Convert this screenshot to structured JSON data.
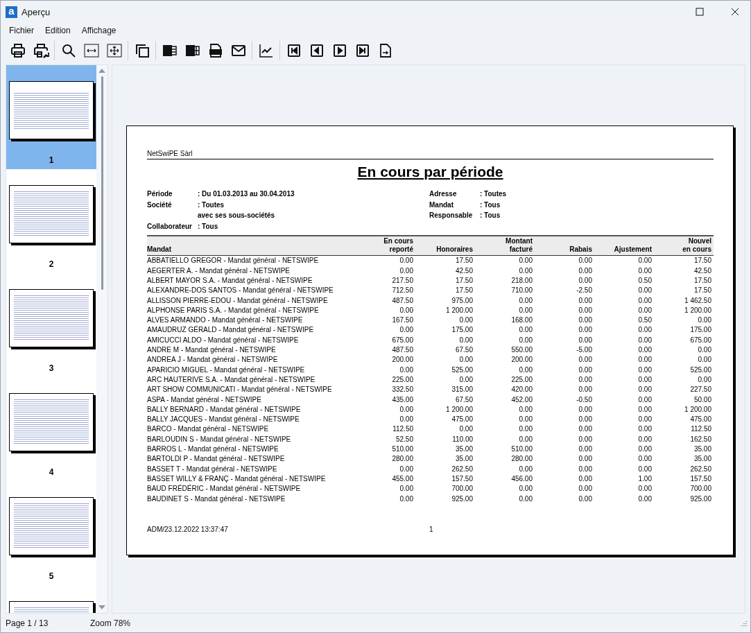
{
  "window": {
    "logo": "a",
    "title": "Aperçu"
  },
  "menu": [
    "Fichier",
    "Edition",
    "Affichage"
  ],
  "thumbnails": [
    {
      "label": "1",
      "selected": true
    },
    {
      "label": "2",
      "selected": false
    },
    {
      "label": "3",
      "selected": false
    },
    {
      "label": "4",
      "selected": false
    },
    {
      "label": "5",
      "selected": false
    },
    {
      "selected": false
    }
  ],
  "report": {
    "company": "NetSwiPE Sàrl",
    "title": "En cours par période",
    "filters_left": [
      {
        "label": "Période",
        "value": ": Du 01.03.2013 au 30.04.2013"
      },
      {
        "label": "Société",
        "value": ": Toutes"
      },
      {
        "value": "avec ses sous-sociétés"
      },
      {
        "label": "Collaborateur",
        "value": ": Tous"
      }
    ],
    "filters_right": [
      {
        "label": "Adresse",
        "value": ": Toutes"
      },
      {
        "label": "Mandat",
        "value": ": Tous"
      },
      {
        "label": "Responsable",
        "value": ": Tous"
      }
    ],
    "header_rows": [
      [
        null,
        "En cours",
        null,
        "Montant",
        null,
        null,
        "Nouvel"
      ],
      [
        "Mandat",
        "reporté",
        "Honoraires",
        "facturé",
        "Rabais",
        "Ajustement",
        "en cours"
      ]
    ],
    "rows": [
      [
        "ABBATIELLO GREGOR - Mandat général - NETSWIPE",
        "0.00",
        "17.50",
        "0.00",
        "0.00",
        "0.00",
        "17.50"
      ],
      [
        "AEGERTER A. - Mandat général - NETSWIPE",
        "0.00",
        "42.50",
        "0.00",
        "0.00",
        "0.00",
        "42.50"
      ],
      [
        "ALBERT MAYOR S.A. - Mandat général - NETSWIPE",
        "217.50",
        "17.50",
        "218.00",
        "0.00",
        "0.50",
        "17.50"
      ],
      [
        "ALEXANDRE-DOS SANTOS - Mandat général - NETSWIPE",
        "712.50",
        "17.50",
        "710.00",
        "-2.50",
        "0.00",
        "17.50"
      ],
      [
        "ALLISSON PIERRE-EDOU - Mandat général - NETSWIPE",
        "487.50",
        "975.00",
        "0.00",
        "0.00",
        "0.00",
        "1 462.50"
      ],
      [
        "ALPHONSE PARIS S.A. - Mandat général - NETSWIPE",
        "0.00",
        "1 200.00",
        "0.00",
        "0.00",
        "0.00",
        "1 200.00"
      ],
      [
        "ALVES ARMANDO - Mandat général - NETSWIPE",
        "167.50",
        "0.00",
        "168.00",
        "0.00",
        "0.50",
        "0.00"
      ],
      [
        "AMAUDRUZ GÉRALD - Mandat général - NETSWIPE",
        "0.00",
        "175.00",
        "0.00",
        "0.00",
        "0.00",
        "175.00"
      ],
      [
        "AMICUCCI ALDO - Mandat général - NETSWIPE",
        "675.00",
        "0.00",
        "0.00",
        "0.00",
        "0.00",
        "675.00"
      ],
      [
        "ANDRE M - Mandat général - NETSWIPE",
        "487.50",
        "67.50",
        "550.00",
        "-5.00",
        "0.00",
        "0.00"
      ],
      [
        "ANDREA J - Mandat général - NETSWIPE",
        "200.00",
        "0.00",
        "200.00",
        "0.00",
        "0.00",
        "0.00"
      ],
      [
        "APARICIO MIGUEL - Mandat général - NETSWIPE",
        "0.00",
        "525.00",
        "0.00",
        "0.00",
        "0.00",
        "525.00"
      ],
      [
        "ARC HAUTERIVE S.A. - Mandat général - NETSWIPE",
        "225.00",
        "0.00",
        "225.00",
        "0.00",
        "0.00",
        "0.00"
      ],
      [
        "ART SHOW COMMUNICATI - Mandat général - NETSWIPE",
        "332.50",
        "315.00",
        "420.00",
        "0.00",
        "0.00",
        "227.50"
      ],
      [
        "ASPA - Mandat général - NETSWIPE",
        "435.00",
        "67.50",
        "452.00",
        "-0.50",
        "0.00",
        "50.00"
      ],
      [
        "BALLY BERNARD - Mandat général - NETSWIPE",
        "0.00",
        "1 200.00",
        "0.00",
        "0.00",
        "0.00",
        "1 200.00"
      ],
      [
        "BALLY JACQUES - Mandat général - NETSWIPE",
        "0.00",
        "475.00",
        "0.00",
        "0.00",
        "0.00",
        "475.00"
      ],
      [
        "BARCO - Mandat général - NETSWIPE",
        "112.50",
        "0.00",
        "0.00",
        "0.00",
        "0.00",
        "112.50"
      ],
      [
        "BARLOUDIN S - Mandat général - NETSWIPE",
        "52.50",
        "110.00",
        "0.00",
        "0.00",
        "0.00",
        "162.50"
      ],
      [
        "BARROS L - Mandat général - NETSWIPE",
        "510.00",
        "35.00",
        "510.00",
        "0.00",
        "0.00",
        "35.00"
      ],
      [
        "BARTOLDI P - Mandat général - NETSWIPE",
        "280.00",
        "35.00",
        "280.00",
        "0.00",
        "0.00",
        "35.00"
      ],
      [
        "BASSET T - Mandat général - NETSWIPE",
        "0.00",
        "262.50",
        "0.00",
        "0.00",
        "0.00",
        "262.50"
      ],
      [
        "BASSET WILLY & FRANÇ - Mandat général - NETSWIPE",
        "455.00",
        "157.50",
        "456.00",
        "0.00",
        "1.00",
        "157.50"
      ],
      [
        "BAUD FRÉDÉRIC - Mandat général - NETSWIPE",
        "0.00",
        "700.00",
        "0.00",
        "0.00",
        "0.00",
        "700.00"
      ],
      [
        "BAUDINET S - Mandat général - NETSWIPE",
        "0.00",
        "925.00",
        "0.00",
        "0.00",
        "0.00",
        "925.00"
      ]
    ],
    "footer_left": "ADM/23.12.2022 13:37:47",
    "footer_page": "1"
  },
  "status_bar": {
    "page": "Page 1 / 13",
    "zoom": "Zoom 78%"
  }
}
